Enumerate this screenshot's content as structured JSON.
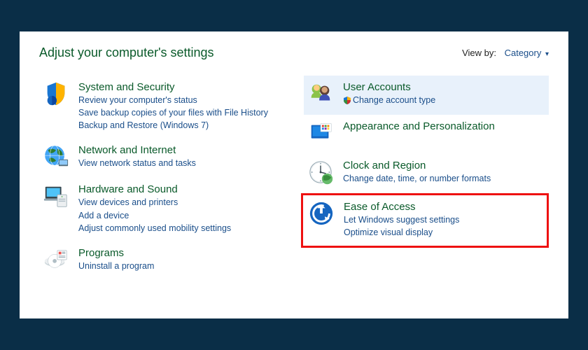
{
  "header": {
    "title": "Adjust your computer's settings",
    "viewby_label": "View by:",
    "viewby_value": "Category"
  },
  "left": [
    {
      "icon": "shield-icon",
      "title": "System and Security",
      "links": [
        "Review your computer's status",
        "Save backup copies of your files with File History",
        "Backup and Restore (Windows 7)"
      ]
    },
    {
      "icon": "globe-icon",
      "title": "Network and Internet",
      "links": [
        "View network status and tasks"
      ]
    },
    {
      "icon": "hardware-icon",
      "title": "Hardware and Sound",
      "links": [
        "View devices and printers",
        "Add a device",
        "Adjust commonly used mobility settings"
      ]
    },
    {
      "icon": "programs-icon",
      "title": "Programs",
      "links": [
        "Uninstall a program"
      ]
    }
  ],
  "right": [
    {
      "icon": "users-icon",
      "title": "User Accounts",
      "links": [
        "Change account type"
      ],
      "link_shield": [
        true
      ],
      "highlight_bg": true
    },
    {
      "icon": "appearance-icon",
      "title": "Appearance and Personalization",
      "links": []
    },
    {
      "icon": "clock-icon",
      "title": "Clock and Region",
      "links": [
        "Change date, time, or number formats"
      ]
    },
    {
      "icon": "ease-icon",
      "title": "Ease of Access",
      "links": [
        "Let Windows suggest settings",
        "Optimize visual display"
      ],
      "highlight_red": true
    }
  ]
}
